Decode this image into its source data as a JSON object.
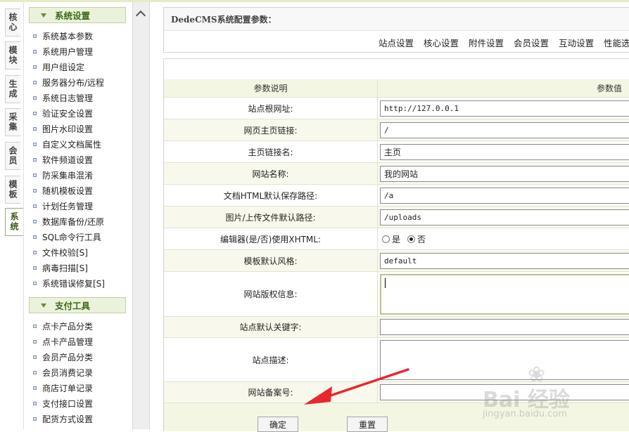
{
  "left_tabs": [
    {
      "label": "核心",
      "active": false
    },
    {
      "label": "模块",
      "active": false
    },
    {
      "label": "生成",
      "active": false
    },
    {
      "label": "采集",
      "active": false
    },
    {
      "label": "会员",
      "active": false
    },
    {
      "label": "模板",
      "active": false
    },
    {
      "label": "系统",
      "active": true
    }
  ],
  "menu": {
    "group1_title": "系统设置",
    "group1_items": [
      "系统基本参数",
      "系统用户管理",
      "用户组设定",
      "服务器分布/远程",
      "系统日志管理",
      "验证安全设置",
      "图片水印设置",
      "自定义文档属性",
      "软件频道设置",
      "防采集串混淆",
      "随机模板设置",
      "计划任务管理",
      "数据库备份/还原",
      "SQL命令行工具",
      "文件校验[S]",
      "病毒扫描[S]",
      "系统错误修复[S]"
    ],
    "group2_title": "支付工具",
    "group2_items": [
      "点卡产品分类",
      "点卡产品管理",
      "会员产品分类",
      "会员消费记录",
      "商店订单记录",
      "支付接口设置",
      "配货方式设置"
    ]
  },
  "main": {
    "title": "DedeCMS系统配置参数：",
    "tabs": [
      "站点设置",
      "核心设置",
      "附件设置",
      "会员设置",
      "互动设置",
      "性能选"
    ],
    "table_header": {
      "label": "参数说明",
      "value": "参数值"
    },
    "fields": [
      {
        "label": "站点根网址:",
        "value": "http://127.0.0.1"
      },
      {
        "label": "网页主页链接:",
        "value": "/"
      },
      {
        "label": "主页链接名:",
        "value": "主页"
      },
      {
        "label": "网站名称:",
        "value": "我的网站"
      },
      {
        "label": "文档HTML默认保存路径:",
        "value": "/a"
      },
      {
        "label": "图片/上传文件默认路径:",
        "value": "/uploads"
      },
      {
        "label": "编辑器(是/否)使用XHTML:",
        "radio_yes": "是",
        "radio_no": "否",
        "selected": "否"
      },
      {
        "label": "模板默认风格:",
        "value": "default"
      },
      {
        "label": "网站版权信息:",
        "value": ""
      },
      {
        "label": "站点默认关键字:",
        "value": ""
      },
      {
        "label": "站点描述:",
        "value": ""
      },
      {
        "label": "网站备案号:",
        "value": ""
      }
    ],
    "buttons": {
      "confirm": "确定",
      "reset": "重置"
    }
  },
  "watermark": {
    "brand": "Bai 经验",
    "url": "jingyan.baidu.com"
  },
  "colors": {
    "menu_header_bg": "#eaf2dc",
    "menu_header_text": "#3e6a14",
    "row_odd": "#f8f9ec",
    "annotation_arrow": "#e8272f"
  }
}
